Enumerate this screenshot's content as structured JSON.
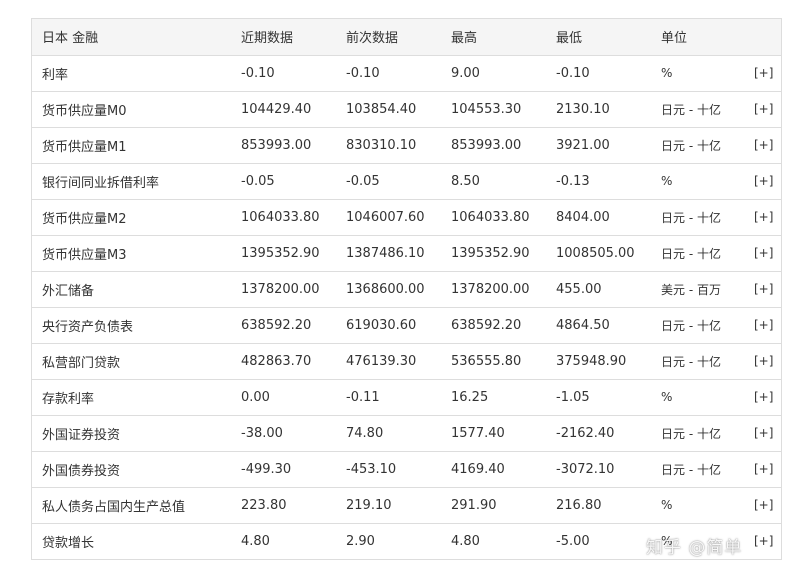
{
  "table": {
    "headers": [
      "日本 金融",
      "近期数据",
      "前次数据",
      "最高",
      "最低",
      "单位",
      ""
    ],
    "more_label": "[+]",
    "rows": [
      {
        "name": "利率",
        "recent": "-0.10",
        "previous": "-0.10",
        "high": "9.00",
        "low": "-0.10",
        "unit": "%"
      },
      {
        "name": "货币供应量M0",
        "recent": "104429.40",
        "previous": "103854.40",
        "high": "104553.30",
        "low": "2130.10",
        "unit": "日元 - 十亿"
      },
      {
        "name": "货币供应量M1",
        "recent": "853993.00",
        "previous": "830310.10",
        "high": "853993.00",
        "low": "3921.00",
        "unit": "日元 - 十亿"
      },
      {
        "name": "银行间同业拆借利率",
        "recent": "-0.05",
        "previous": "-0.05",
        "high": "8.50",
        "low": "-0.13",
        "unit": "%"
      },
      {
        "name": "货币供应量M2",
        "recent": "1064033.80",
        "previous": "1046007.60",
        "high": "1064033.80",
        "low": "8404.00",
        "unit": "日元 - 十亿"
      },
      {
        "name": "货币供应量M3",
        "recent": "1395352.90",
        "previous": "1387486.10",
        "high": "1395352.90",
        "low": "1008505.00",
        "unit": "日元 - 十亿"
      },
      {
        "name": "外汇储备",
        "recent": "1378200.00",
        "previous": "1368600.00",
        "high": "1378200.00",
        "low": "455.00",
        "unit": "美元 - 百万"
      },
      {
        "name": "央行资产负债表",
        "recent": "638592.20",
        "previous": "619030.60",
        "high": "638592.20",
        "low": "4864.50",
        "unit": "日元 - 十亿"
      },
      {
        "name": "私营部门贷款",
        "recent": "482863.70",
        "previous": "476139.30",
        "high": "536555.80",
        "low": "375948.90",
        "unit": "日元 - 十亿"
      },
      {
        "name": "存款利率",
        "recent": "0.00",
        "previous": "-0.11",
        "high": "16.25",
        "low": "-1.05",
        "unit": "%"
      },
      {
        "name": "外国证券投资",
        "recent": "-38.00",
        "previous": "74.80",
        "high": "1577.40",
        "low": "-2162.40",
        "unit": "日元 - 十亿"
      },
      {
        "name": "外国债券投资",
        "recent": "-499.30",
        "previous": "-453.10",
        "high": "4169.40",
        "low": "-3072.10",
        "unit": "日元 - 十亿"
      },
      {
        "name": "私人债务占国内生产总值",
        "recent": "223.80",
        "previous": "219.10",
        "high": "291.90",
        "low": "216.80",
        "unit": "%"
      },
      {
        "name": "贷款增长",
        "recent": "4.80",
        "previous": "2.90",
        "high": "4.80",
        "low": "-5.00",
        "unit": "%"
      }
    ]
  },
  "watermark": {
    "text": "知乎 @简单"
  }
}
